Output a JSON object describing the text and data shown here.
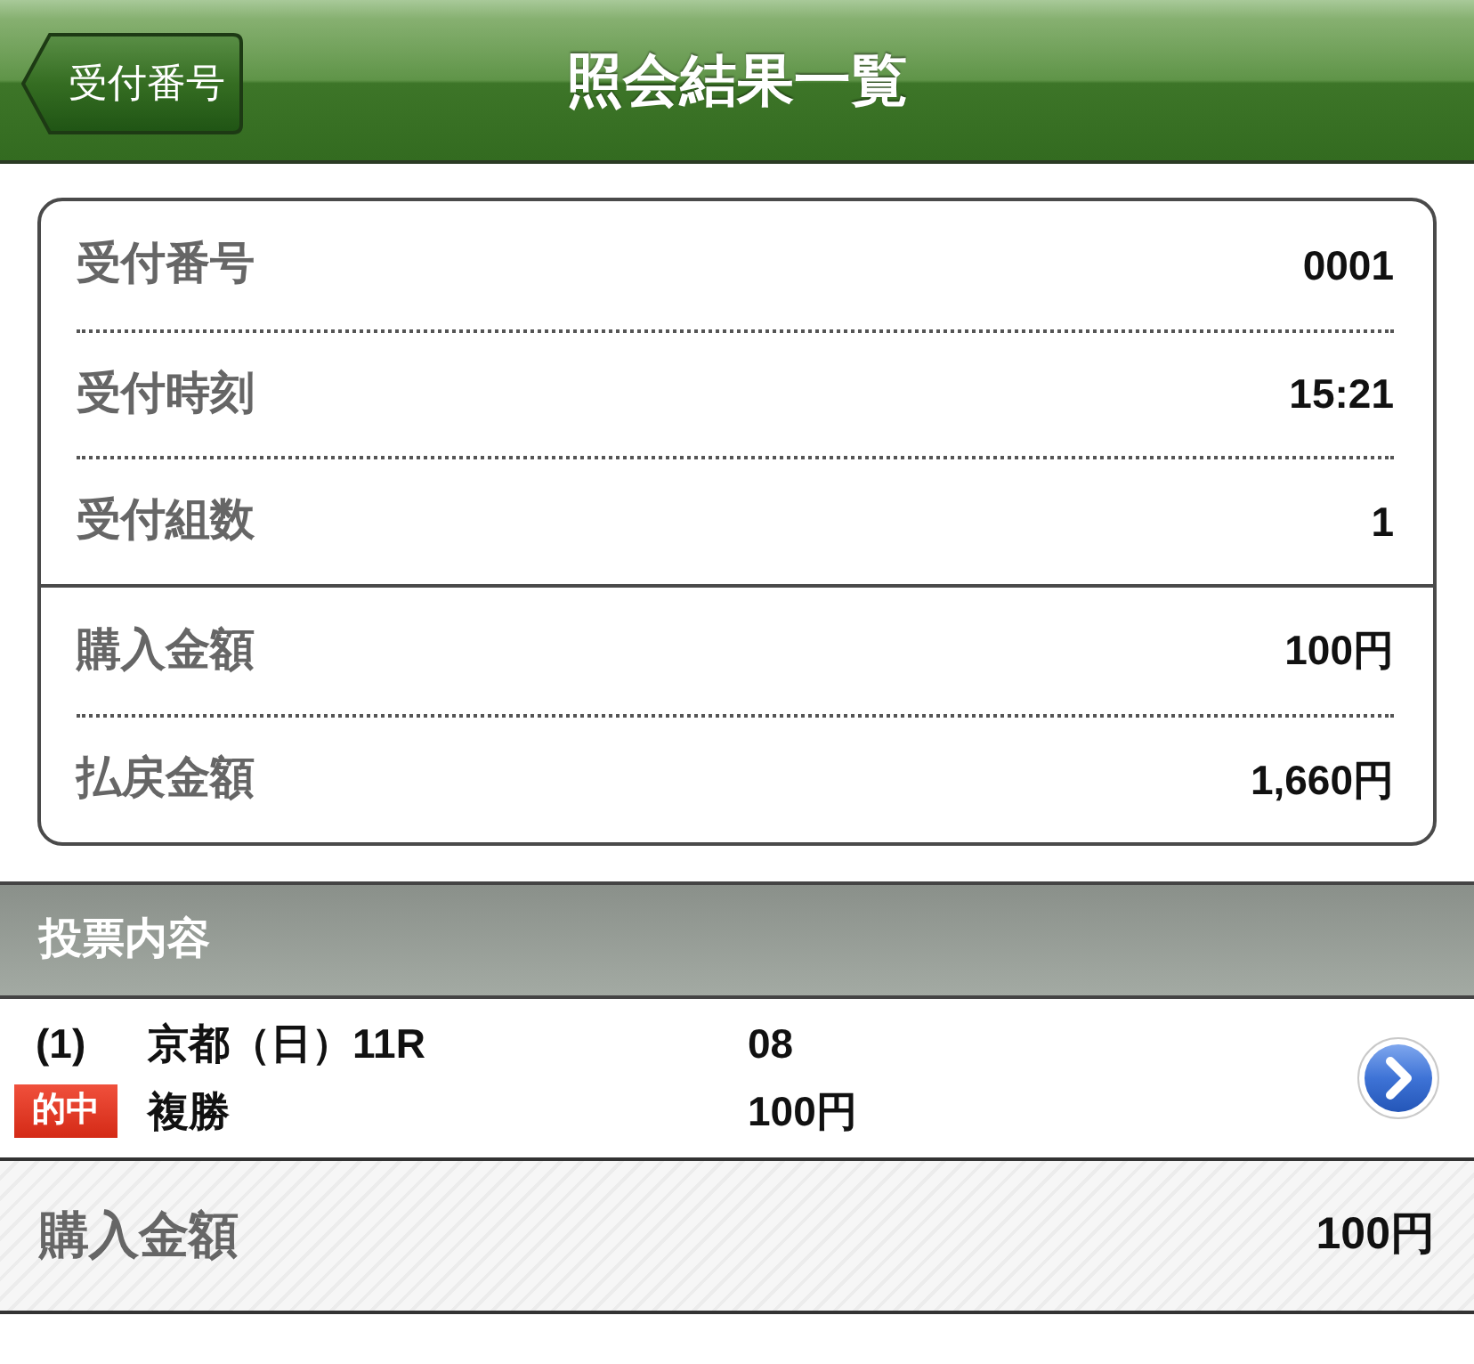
{
  "header": {
    "back_button": "受付番号",
    "title": "照会結果一覧"
  },
  "summary": {
    "groups": [
      [
        {
          "label": "受付番号",
          "value": "0001"
        },
        {
          "label": "受付時刻",
          "value": "15:21"
        },
        {
          "label": "受付組数",
          "value": "1"
        }
      ],
      [
        {
          "label": "購入金額",
          "value": "100円"
        },
        {
          "label": "払戻金額",
          "value": "1,660円"
        }
      ]
    ]
  },
  "section": {
    "title": "投票内容"
  },
  "bets": [
    {
      "number": "(1)",
      "race": "京都（日）11R",
      "selection": "08",
      "badge": "的中",
      "bet_type": "複勝",
      "amount": "100円"
    }
  ],
  "total": {
    "label": "購入金額",
    "value": "100円"
  }
}
